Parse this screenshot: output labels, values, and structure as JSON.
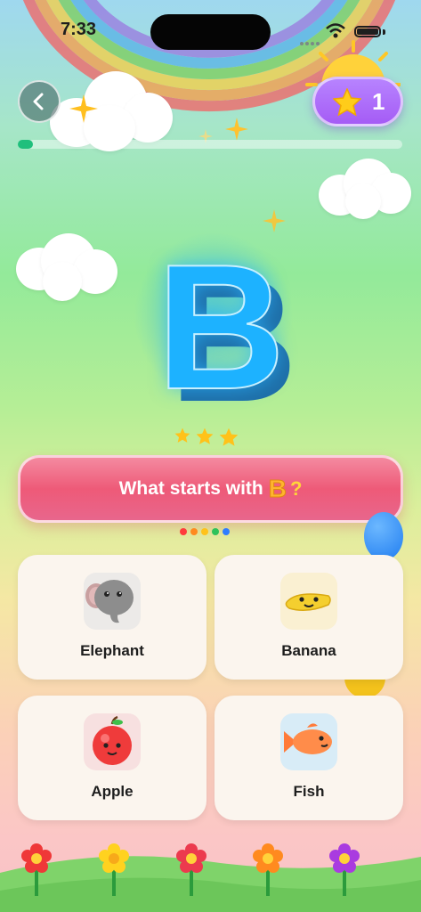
{
  "status_bar": {
    "time": "7:33"
  },
  "header": {
    "back_icon": "chevron-left-icon",
    "score": "1",
    "score_icon": "star-icon"
  },
  "progress": {
    "fraction": 0.04
  },
  "letter": {
    "value": "B"
  },
  "rating": {
    "stars": 3
  },
  "question": {
    "prefix": "What starts with",
    "letter": "B",
    "suffix": "?"
  },
  "pagination_dots": [
    "#ff3b3b",
    "#ff8a1f",
    "#ffc21a",
    "#2ec25a",
    "#2f7cff"
  ],
  "answers": [
    {
      "label": "Elephant",
      "icon": "elephant-icon"
    },
    {
      "label": "Banana",
      "icon": "banana-icon"
    },
    {
      "label": "Apple",
      "icon": "apple-icon"
    },
    {
      "label": "Fish",
      "icon": "fish-icon"
    }
  ],
  "colors": {
    "accent_purple": "#a55cf5",
    "question_pink": "#ee5a78",
    "letter_blue": "#1db2ff",
    "progress_green": "#1fbf7c"
  }
}
